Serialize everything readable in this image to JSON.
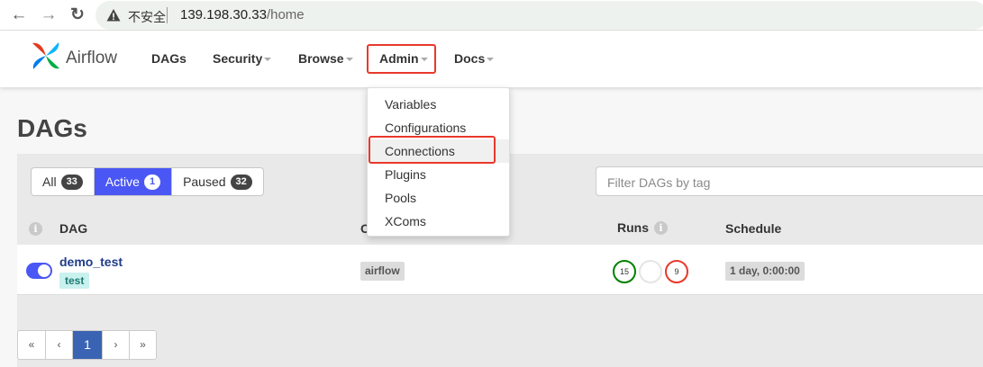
{
  "browser": {
    "back_glyph": "←",
    "forward_glyph": "→",
    "reload_glyph": "↻",
    "security_text": "不安全",
    "url_host": "139.198.30.33",
    "url_path": "/home"
  },
  "app": {
    "brand": "Airflow",
    "nav": {
      "dags": "DAGs",
      "security": "Security",
      "browse": "Browse",
      "admin": "Admin",
      "docs": "Docs"
    },
    "admin_menu": [
      "Variables",
      "Configurations",
      "Connections",
      "Plugins",
      "Pools",
      "XComs"
    ]
  },
  "page": {
    "title": "DAGs",
    "filters": {
      "all_label": "All",
      "all_count": "33",
      "active_label": "Active",
      "active_count": "1",
      "paused_label": "Paused",
      "paused_count": "32"
    },
    "tag_filter_placeholder": "Filter DAGs by tag",
    "info_glyph": "i",
    "columns": {
      "dag": "DAG",
      "owner_initial": "O",
      "runs": "Runs",
      "schedule": "Schedule"
    },
    "rows": [
      {
        "dag_id": "demo_test",
        "tag": "test",
        "owner": "airflow",
        "runs_success": "15",
        "runs_running": "",
        "runs_failed": "9",
        "schedule": "1 day, 0:00:00"
      }
    ],
    "pagination": {
      "first": "«",
      "prev": "‹",
      "current": "1",
      "next": "›",
      "last": "»"
    }
  },
  "colors": {
    "accent": "#4a57f4",
    "highlight_box": "#e8392b",
    "success": "#008000",
    "failed": "#e8392b",
    "page_active": "#3a63b3"
  }
}
